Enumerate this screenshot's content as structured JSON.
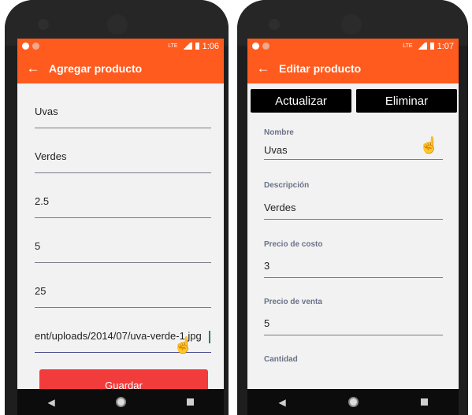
{
  "left_screen": {
    "status_time": "1:06",
    "network": "LTE",
    "title": "Agregar producto",
    "fields": [
      "Uvas",
      "Verdes",
      "2.5",
      "5",
      "25",
      "ent/uploads/2014/07/uva-verde-1.jpg"
    ],
    "save_label": "Guardar"
  },
  "right_screen": {
    "status_time": "1:07",
    "network": "LTE",
    "title": "Editar producto",
    "update_label": "Actualizar",
    "delete_label": "Eliminar",
    "fields": [
      {
        "label": "Nombre",
        "value": "Uvas"
      },
      {
        "label": "Descripción",
        "value": "Verdes"
      },
      {
        "label": "Precio de costo",
        "value": "3"
      },
      {
        "label": "Precio de venta",
        "value": "5"
      },
      {
        "label": "Cantidad",
        "value": ""
      }
    ]
  },
  "icons": {
    "back": "arrow-left-icon",
    "nav_back": "triangle-back-icon",
    "nav_home": "circle-home-icon",
    "nav_recent": "square-recent-icon",
    "cursor": "hand-pointer-icon"
  },
  "colors": {
    "accent": "#ff5b1f",
    "save_button": "#f23b3b",
    "action_button": "#000000"
  }
}
